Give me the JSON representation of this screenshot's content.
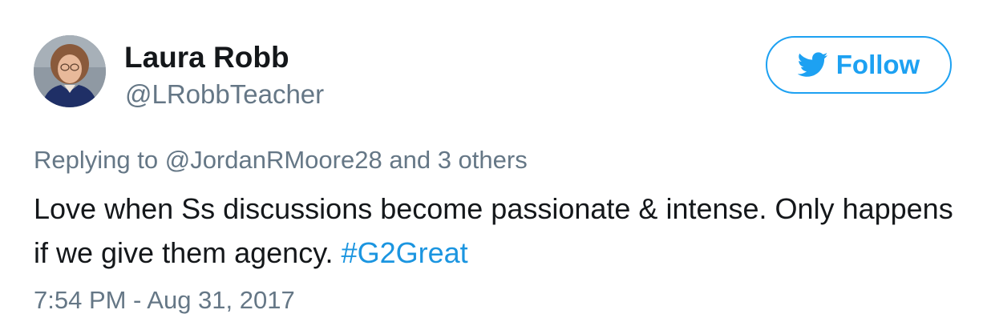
{
  "author": {
    "display_name": "Laura Robb",
    "handle": "@LRobbTeacher"
  },
  "follow_button": {
    "label": "Follow",
    "icon": "twitter-bird-icon",
    "color": "#1da1f2"
  },
  "reply": {
    "prefix": "Replying to",
    "mention": "@JordanRMoore28",
    "connector": "and",
    "others": "3 others"
  },
  "tweet": {
    "text": "Love when Ss discussions become passionate & intense. Only happens if we give them agency.",
    "hashtag": "#G2Great",
    "hashtag_color": "#1b95e0"
  },
  "timestamp": "7:54 PM - Aug 31, 2017"
}
